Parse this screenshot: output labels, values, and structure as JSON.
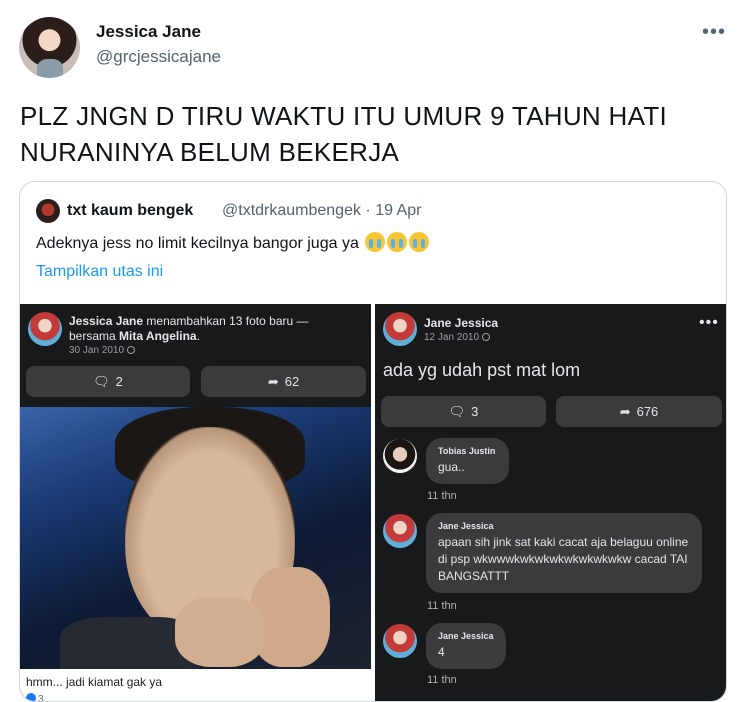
{
  "tweet": {
    "author_name": "Jessica Jane",
    "author_handle": "@grcjessicajane",
    "more_icon": "•••",
    "text": "PLZ JNGN D TIRU WAKTU ITU UMUR 9 TAHUN HATI NURANINYA BELUM BEKERJA"
  },
  "quote": {
    "author_name": "txt kaum bengek",
    "handle_and_date": "@txtdrkaumbengek · 19 Apr",
    "text": "Adeknya jess no limit kecilnya bangor juga ya",
    "emoji_name": "loudly-crying-face-emoji",
    "show_thread": "Tampilkan utas ini"
  },
  "left_post": {
    "name": "Jessica Jane",
    "action_line1": " menambahkan 13 foto baru —",
    "action_line2_prefix": "bersama ",
    "tagged": "Mita Angelina",
    "action_line2_suffix": ".",
    "date": "30 Jan 2010",
    "comments_count": "2",
    "shares_count": "62",
    "caption": "hmm... jadi kiamat gak ya",
    "reactions_count": "3"
  },
  "right_post": {
    "name": "Jane Jessica",
    "date": "12 Jan 2010",
    "more_icon": "•••",
    "text": "ada yg udah pst mat lom",
    "comments_count": "3",
    "shares_count": "676",
    "comments": [
      {
        "author": "Tobias Justin",
        "text": "gua..",
        "time": "11 thn"
      },
      {
        "author": "Jane Jessica",
        "text": "apaan sih jink sat kaki cacat aja belaguu online di psp wkwwwkwkwkwkwkwkwkwkw cacad TAI BANGSATTT",
        "time": "11 thn"
      },
      {
        "author": "Jane Jessica",
        "text": "4",
        "time": "11 thn"
      }
    ]
  },
  "colors": {
    "link_blue": "#1d9bf0",
    "fb_dark": "#18191a",
    "fb_button": "#3a3b3c",
    "fb_bubble": "#3a3b3c"
  }
}
